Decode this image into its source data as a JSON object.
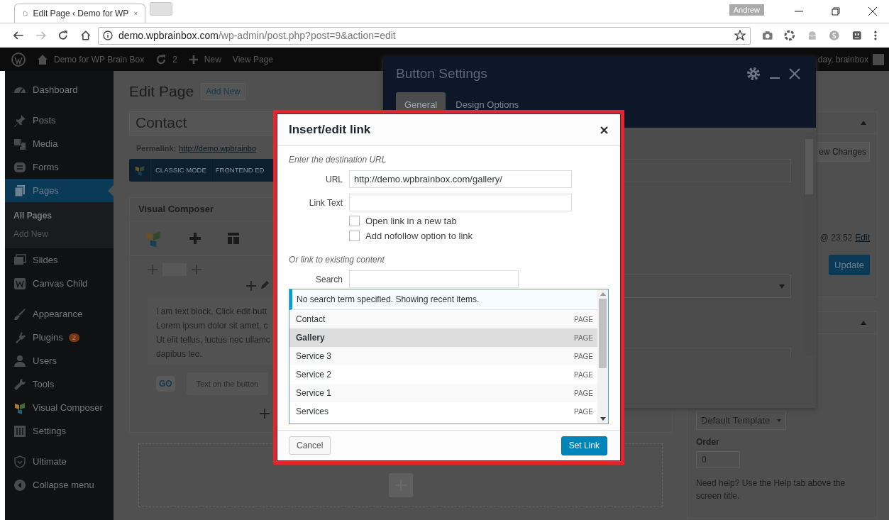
{
  "browser": {
    "tab_title": "Edit Page ‹ Demo for WP",
    "profile": "Andrew",
    "url_host": "demo.wpbrainbox.com",
    "url_path": "/wp-admin/post.php?post=9&action=edit"
  },
  "admin_bar": {
    "site": "Demo for WP Brain Box",
    "updates": "2",
    "new": "New",
    "view": "View Page",
    "greeting": "day, brainbox"
  },
  "sidebar": [
    {
      "kind": "item",
      "label": "Dashboard",
      "selected": false
    },
    {
      "kind": "separator"
    },
    {
      "kind": "item",
      "label": "Posts",
      "selected": false
    },
    {
      "kind": "item",
      "label": "Media",
      "selected": false
    },
    {
      "kind": "item",
      "label": "Forms",
      "selected": false
    },
    {
      "kind": "item",
      "label": "Pages",
      "selected": true,
      "children": [
        {
          "label": "All Pages",
          "selected": true
        },
        {
          "label": "Add New",
          "selected": false
        }
      ]
    },
    {
      "kind": "item",
      "label": "Slides",
      "selected": false
    },
    {
      "kind": "item",
      "label": "Canvas Child",
      "selected": false
    },
    {
      "kind": "separator"
    },
    {
      "kind": "item",
      "label": "Appearance",
      "selected": false
    },
    {
      "kind": "item",
      "label": "Plugins",
      "selected": false,
      "badge": "2"
    },
    {
      "kind": "item",
      "label": "Users",
      "selected": false
    },
    {
      "kind": "item",
      "label": "Tools",
      "selected": false
    },
    {
      "kind": "item",
      "label": "Visual Composer",
      "selected": false
    },
    {
      "kind": "item",
      "label": "Settings",
      "selected": false
    },
    {
      "kind": "separator"
    },
    {
      "kind": "item",
      "label": "Ultimate",
      "selected": false
    },
    {
      "kind": "item",
      "label": "Collapse menu",
      "selected": false
    }
  ],
  "editor": {
    "page_title": "Edit Page",
    "add_new": "Add New",
    "post_title": "Contact",
    "permalink_label": "Permalink:",
    "permalink_url": "http://demo.wpbrainbo",
    "vc_modes": [
      "CLASSIC MODE",
      "FRONTEND ED"
    ],
    "composer_title": "Visual Composer",
    "text_block": [
      "I am text block. Click edit butt",
      "Lorem ipsum dolor sit amet, c",
      "Ut elit tellus, luctus nec ullamc",
      "dapibus leo."
    ],
    "go": "GO",
    "button_text": "Text on the button"
  },
  "publish": {
    "preview": "ew Changes",
    "time": "@ 23:52",
    "edit": "Edit",
    "update": "Update",
    "template": "Default Template",
    "order_label": "Order",
    "order_value": "0",
    "help": "Need help? Use the Help tab above the screen title."
  },
  "button_settings": {
    "title": "Button Settings",
    "tabs": [
      {
        "label": "General",
        "selected": true
      },
      {
        "label": "Design Options",
        "selected": false
      }
    ]
  },
  "link_dialog": {
    "title": "Insert/edit link",
    "intro": "Enter the destination URL",
    "url_label": "URL",
    "url": "http://demo.wpbrainbox.com/gallery/",
    "text_label": "Link Text",
    "options": [
      {
        "label": "Open link in a new tab",
        "checked": false
      },
      {
        "label": "Add nofollow option to link",
        "checked": false
      }
    ],
    "existing": "Or link to existing content",
    "search_label": "Search",
    "notice": "No search term specified. Showing recent items.",
    "results": [
      {
        "title": "Contact",
        "type": "PAGE",
        "selected": false
      },
      {
        "title": "Gallery",
        "type": "PAGE",
        "selected": true
      },
      {
        "title": "Service 3",
        "type": "PAGE",
        "selected": false
      },
      {
        "title": "Service 2",
        "type": "PAGE",
        "selected": false
      },
      {
        "title": "Service 1",
        "type": "PAGE",
        "selected": false
      },
      {
        "title": "Services",
        "type": "PAGE",
        "selected": false
      }
    ],
    "cancel": "Cancel",
    "submit": "Set Link"
  }
}
